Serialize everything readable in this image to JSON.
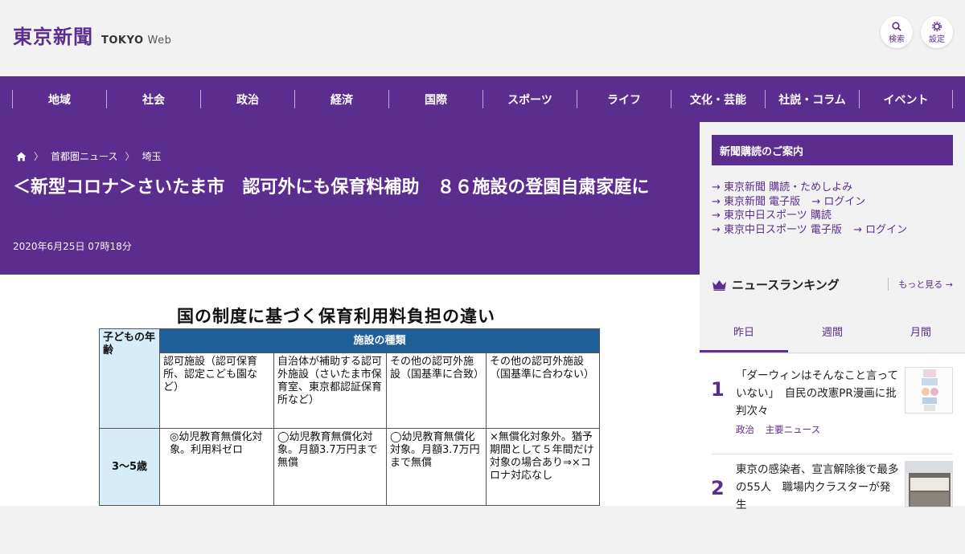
{
  "header": {
    "logo_jp": "東京新聞",
    "logo_en": "TOKYO",
    "logo_web": "Web",
    "search_label": "検索",
    "settings_label": "設定"
  },
  "nav": {
    "items": [
      "地域",
      "社会",
      "政治",
      "経済",
      "国際",
      "スポーツ",
      "ライフ",
      "文化・芸能",
      "社説・コラム",
      "イベント"
    ]
  },
  "article": {
    "breadcrumb": [
      "首都圏ニュース",
      "埼玉"
    ],
    "title": "＜新型コロナ＞さいたま市　認可外にも保育料補助　８６施設の登園自粛家庭に",
    "date": "2020年6月25日 07時18分"
  },
  "figure": {
    "title": "国の制度に基づく保育利用料負担の違い",
    "age_header": "子どもの年齢",
    "group_header": "施設の種類",
    "columns": [
      "認可施設（認可保育所、認定こども園など）",
      "自治体が補助する認可外施設（さいたま市保育室、東京都認証保育所など）",
      "その他の認可外施設（国基準に合致）",
      "その他の認可外施設（国基準に合わない）"
    ],
    "row_age": "3～5歳",
    "row_cells": [
      "◎幼児教育無償化対象。利用料ゼロ",
      "◯幼児教育無償化対象。月額3.7万円まで無償",
      "◯幼児教育無償化対象。月額3.7万円まで無償",
      "×無償化対象外。猶予期間として５年間だけ対象の場合あり⇒×コロナ対応なし"
    ]
  },
  "sidebar": {
    "subscribe_title": "新聞購読のご案内",
    "links": [
      {
        "text": "東京新聞 購読・ためしよみ"
      },
      {
        "text": "東京新聞 電子版",
        "extra": "ログイン"
      },
      {
        "text": "東京中日スポーツ 購読"
      },
      {
        "text": "東京中日スポーツ 電子版",
        "extra": "ログイン"
      }
    ],
    "ranking_title": "ニュースランキング",
    "more_label": "もっと見る",
    "tabs": [
      "昨日",
      "週間",
      "月間"
    ],
    "ranking": [
      {
        "rank": "1",
        "title": "「ダーウィンはそんなこと言っていない」　自民の改憲PR漫画に批判次々",
        "tags": [
          "政治",
          "主要ニュース"
        ]
      },
      {
        "rank": "2",
        "title": "東京の感染者、宣言解除後で最多の55人　職場内クラスターが発生"
      }
    ]
  }
}
